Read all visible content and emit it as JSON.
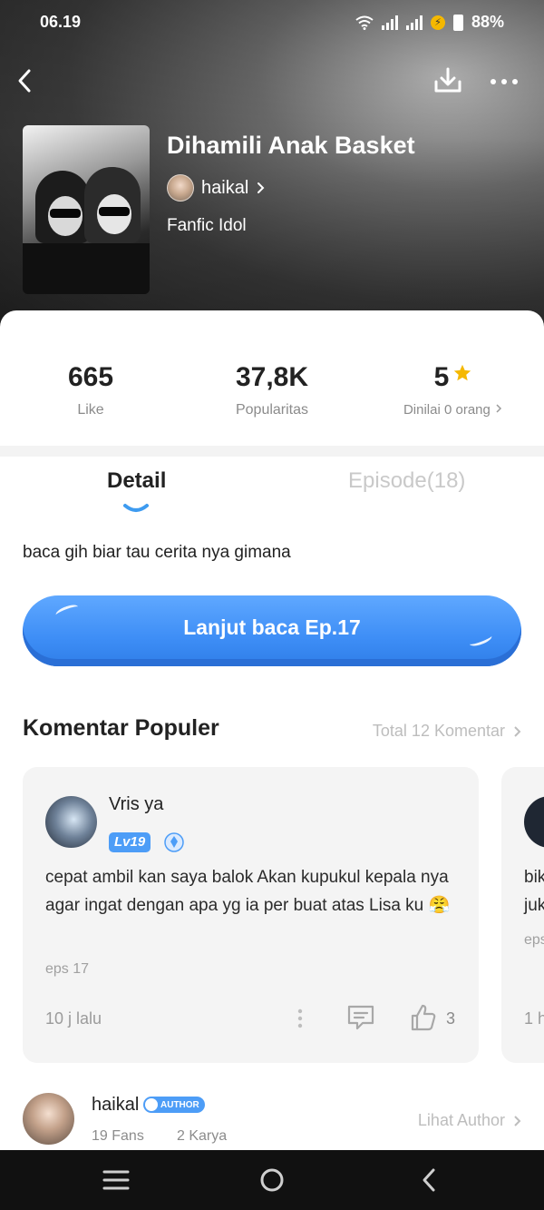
{
  "status_bar": {
    "time": "06.19",
    "battery": "88%"
  },
  "story": {
    "title": "Dihamili Anak Basket",
    "author": "haikal",
    "genre": "Fanfic Idol",
    "description": "baca gih biar tau cerita nya gimana"
  },
  "stats": {
    "likes_value": "665",
    "likes_label": "Like",
    "popularity_value": "37,8K",
    "popularity_label": "Popularitas",
    "rating_value": "5",
    "rating_label": "Dinilai 0 orang"
  },
  "tabs": {
    "detail": "Detail",
    "episode": "Episode(18)"
  },
  "cta": {
    "label": "Lanjut baca Ep.17"
  },
  "comments_section": {
    "title": "Komentar Populer",
    "total_link": "Total 12 Komentar",
    "comments": [
      {
        "user": "Vris ya",
        "level": "Lv19",
        "text": "cepat ambil kan saya balok Akan kupukul kepala nya agar ingat dengan apa yg ia per buat atas Lisa ku 😤",
        "episode": "eps 17",
        "time": "10 j lalu",
        "likes": "3"
      },
      {
        "text_lines": [
          "bik",
          "juk"
        ],
        "episode": "eps",
        "time": "1 h"
      }
    ]
  },
  "author_footer": {
    "name": "haikal",
    "badge": "AUTHOR",
    "fans": "19 Fans",
    "works": "2 Karya",
    "link": "Lihat Author"
  },
  "colors": {
    "accent": "#3e8ef6",
    "star": "#f5b800",
    "muted": "#bdbdbd"
  }
}
